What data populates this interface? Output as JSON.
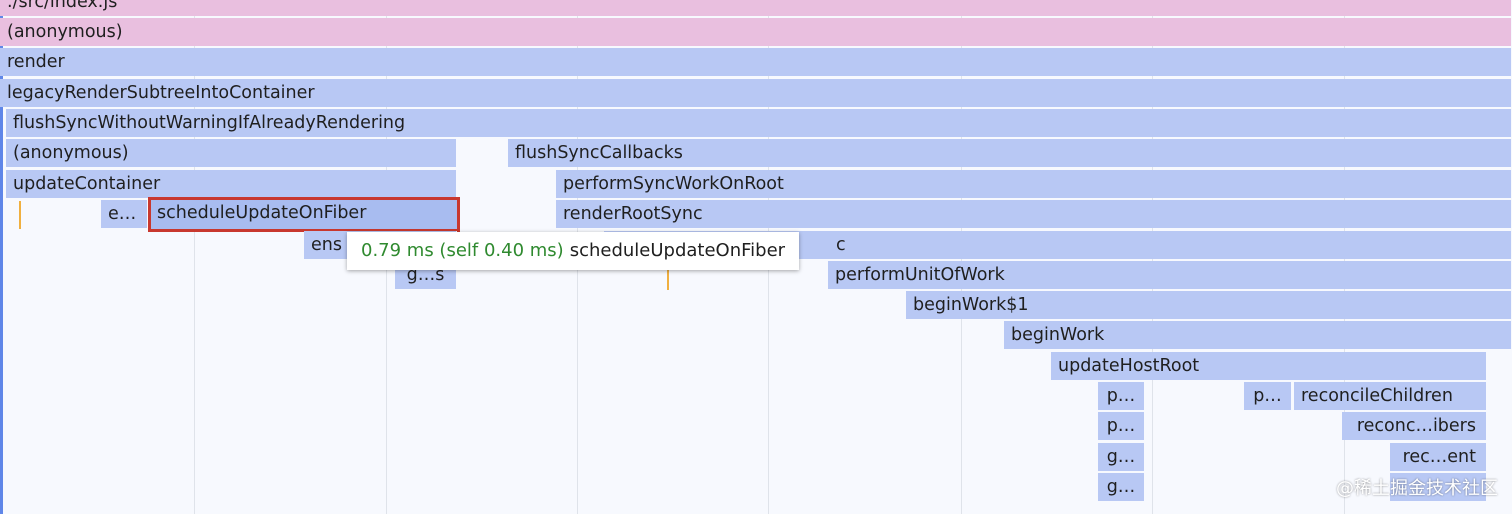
{
  "flame_chart": {
    "rows": [
      [
        {
          "label": "./src/index.js",
          "style": "pink"
        }
      ],
      [
        {
          "label": "(anonymous)",
          "style": "pink"
        }
      ],
      [
        {
          "label": "render",
          "style": "blue"
        }
      ],
      [
        {
          "label": "legacyRenderSubtreeIntoContainer",
          "style": "blue"
        }
      ],
      [
        {
          "label": "flushSyncWithoutWarningIfAlreadyRendering",
          "style": "blue"
        }
      ],
      [
        {
          "label": "(anonymous)",
          "style": "blue"
        },
        {
          "label": "flushSyncCallbacks",
          "style": "blue"
        }
      ],
      [
        {
          "label": "updateContainer",
          "style": "blue"
        },
        {
          "label": "performSyncWorkOnRoot",
          "style": "blue"
        }
      ],
      [
        {
          "label": "e…",
          "style": "blue"
        },
        {
          "label": "scheduleUpdateOnFiber",
          "style": "blue",
          "selected": true
        },
        {
          "label": "renderRootSync",
          "style": "blue"
        }
      ],
      [
        {
          "label": "ens",
          "style": "blue"
        },
        {
          "label": "c",
          "style": "blue"
        }
      ],
      [
        {
          "label": "g…s",
          "style": "blue"
        },
        {
          "label": "performUnitOfWork",
          "style": "blue"
        }
      ],
      [
        {
          "label": "beginWork$1",
          "style": "blue"
        }
      ],
      [
        {
          "label": "beginWork",
          "style": "blue"
        }
      ],
      [
        {
          "label": "updateHostRoot",
          "style": "blue"
        }
      ],
      [
        {
          "label": "p…",
          "style": "blue"
        },
        {
          "label": "p…",
          "style": "blue"
        },
        {
          "label": "reconcileChildren",
          "style": "blue"
        }
      ],
      [
        {
          "label": "p…",
          "style": "blue"
        },
        {
          "label": "reconc…ibers",
          "style": "blue"
        }
      ],
      [
        {
          "label": "g…",
          "style": "blue"
        },
        {
          "label": "rec…ent",
          "style": "blue"
        }
      ],
      [
        {
          "label": "g…",
          "style": "blue"
        },
        {
          "label": "",
          "style": "blue"
        }
      ]
    ]
  },
  "tooltip": {
    "time": "0.79 ms (self 0.40 ms)",
    "function_name": "scheduleUpdateOnFiber"
  },
  "watermark": "@稀土掘金技术社区",
  "colors": {
    "script_bar": "#e9bfdf",
    "function_bar": "#b8c8f4",
    "selection_outline": "#c8382f",
    "tooltip_time": "#2f8a2f",
    "marker": "#f0b040"
  }
}
